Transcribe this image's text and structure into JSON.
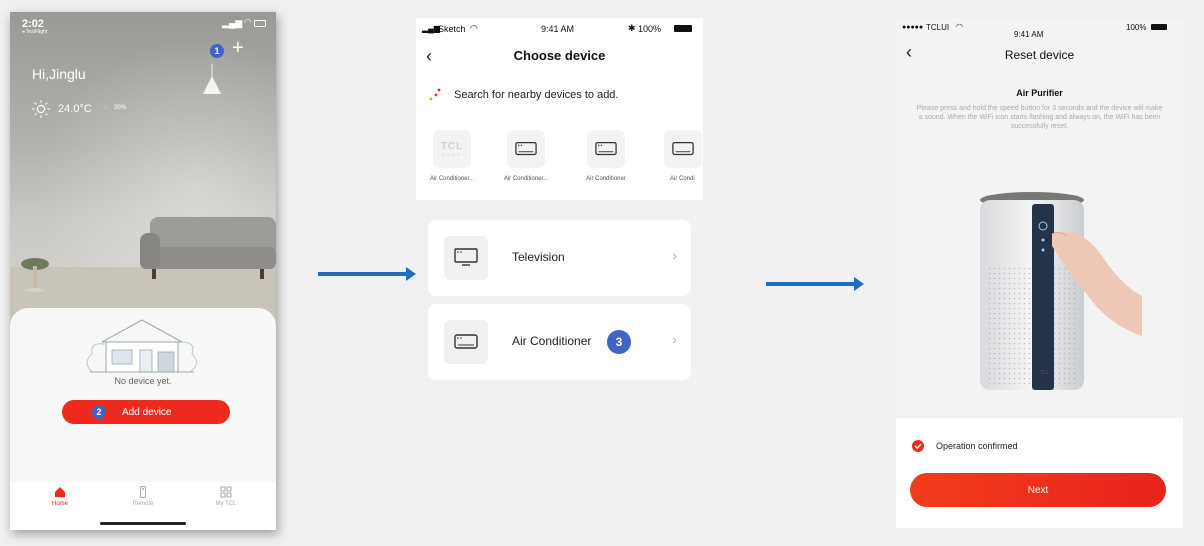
{
  "screen1": {
    "status_time": "2:02",
    "back_link": "◂ TestFlight",
    "greeting": "Hi,Jinglu",
    "weather": "24.0°C",
    "humidity": "20%",
    "badge1": "1",
    "badge2": "2",
    "empty_text": "No device yet.",
    "add_device_label": "Add device",
    "tabs": [
      {
        "label": "Home"
      },
      {
        "label": "Remote"
      },
      {
        "label": "My TCL"
      }
    ],
    "accent": "#ec2b1e"
  },
  "screen2": {
    "carrier": "Sketch",
    "time": "9:41 AM",
    "battery": "100%",
    "title": "Choose device",
    "search_text": "Search for nearby devices to add.",
    "nearby": [
      {
        "label": "Air Conditioner..."
      },
      {
        "label": "Air Conditioner..."
      },
      {
        "label": "Air Conditioner"
      },
      {
        "label": "Air Condi"
      }
    ],
    "tcl_logo": "TCL",
    "tcl_logo_sub": "HOME",
    "categories": [
      {
        "label": "Television"
      },
      {
        "label": "Air Conditioner"
      }
    ],
    "badge3": "3",
    "badge_color": "#3e64c8"
  },
  "screen3": {
    "carrier": "TCLUI",
    "time": "9:41 AM",
    "battery": "100%",
    "title": "Reset device",
    "device_name": "Air Purifier",
    "instructions": "Please press and hold the speed button for 3 seconds and the device will make a sound. When the WiFi icon starts flashing and always on, the WiFi has been successfully reset.",
    "confirm_text": "Operation confirmed",
    "next_label": "Next",
    "product_logo": "TCL"
  }
}
